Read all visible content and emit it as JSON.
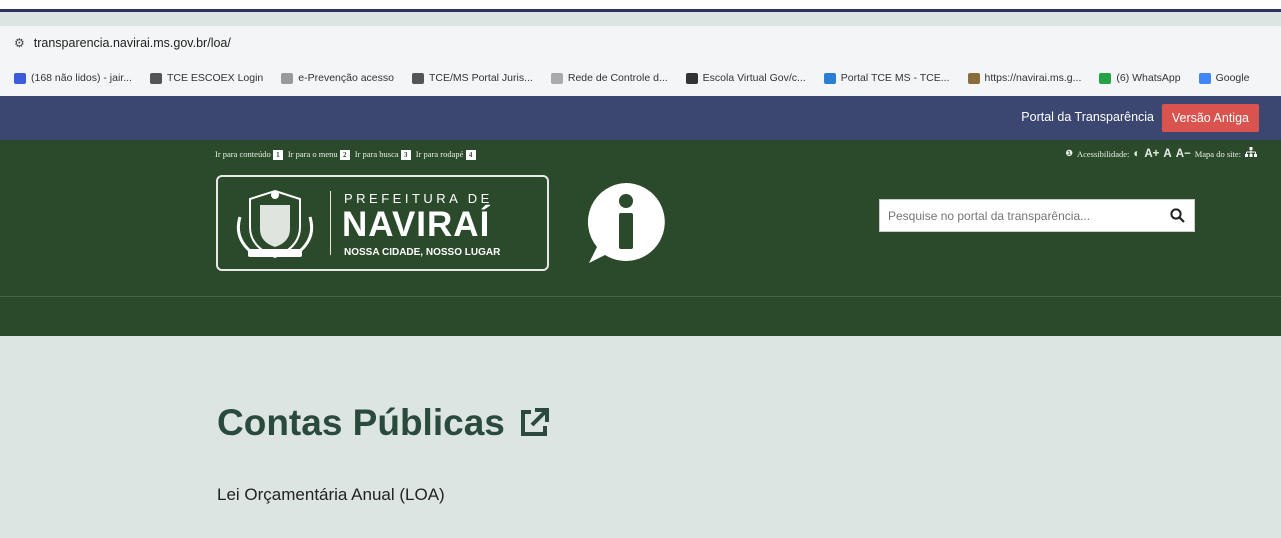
{
  "browser": {
    "url": "transparencia.navirai.ms.gov.br/loa/",
    "bookmarks": [
      {
        "label": "(168 não lidos) - jair...",
        "icon": "mail-icon",
        "color": "#3b5bdb"
      },
      {
        "label": "TCE ESCOEX Login",
        "icon": "tce-icon",
        "color": "#555555"
      },
      {
        "label": "e-Prevenção acesso",
        "icon": "page-icon",
        "color": "#999999"
      },
      {
        "label": "TCE/MS Portal Juris...",
        "icon": "globe-icon",
        "color": "#555555"
      },
      {
        "label": "Rede de Controle d...",
        "icon": "shield-icon",
        "color": "#aaaaaa"
      },
      {
        "label": "Escola Virtual Gov/c...",
        "icon": "ev-icon",
        "color": "#333333"
      },
      {
        "label": "Portal TCE MS - TCE...",
        "icon": "tce-portal-icon",
        "color": "#2a7fd4"
      },
      {
        "label": "https://navirai.ms.g...",
        "icon": "navirai-icon",
        "color": "#8a6d3b"
      },
      {
        "label": "(6) WhatsApp",
        "icon": "whatsapp-icon",
        "color": "#25a244"
      },
      {
        "label": "Google",
        "icon": "google-icon",
        "color": "#4285f4"
      }
    ]
  },
  "portal_bar": {
    "title": "Portal da Transparência",
    "old_version": "Versão Antiga"
  },
  "header": {
    "skip_links": [
      {
        "label": "Ir para conteúdo",
        "num": "1"
      },
      {
        "label": "Ir para o menu",
        "num": "2"
      },
      {
        "label": "Ir para busca",
        "num": "3"
      },
      {
        "label": "Ir para rodapé",
        "num": "4"
      }
    ],
    "accessibility_label": "Acessibilidade:",
    "font_increase": "A+",
    "font_normal": "A",
    "font_decrease": "A−",
    "sitemap_label": "Mapa do site:",
    "logo": {
      "top": "PREFEITURA DE",
      "name": "NAVIRAÍ",
      "slogan": "NOSSA CIDADE, NOSSO LUGAR"
    },
    "search_placeholder": "Pesquise no portal da transparência..."
  },
  "content": {
    "title": "Contas Públicas",
    "subtitle": "Lei Orçamentária Anual (LOA)"
  }
}
